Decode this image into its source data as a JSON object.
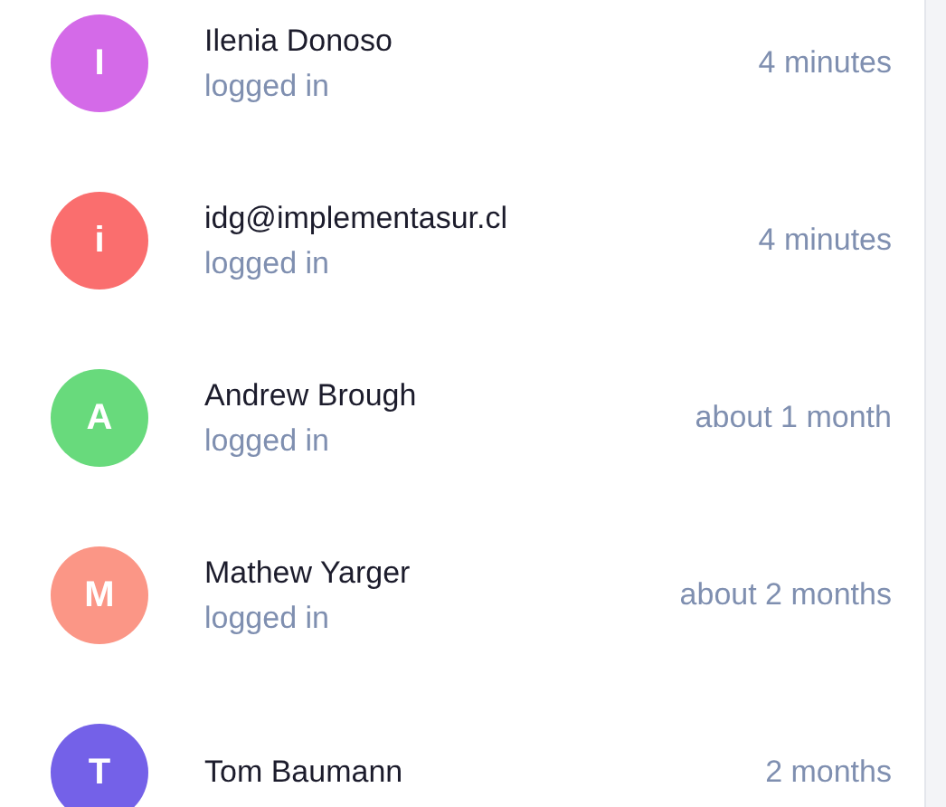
{
  "activity": [
    {
      "initial": "I",
      "color": "#d46ae8",
      "name": "Ilenia Donoso",
      "action": "logged in",
      "time": "4 minutes"
    },
    {
      "initial": "i",
      "color": "#fa6e6e",
      "name": "idg@implementasur.cl",
      "action": "logged in",
      "time": "4 minutes"
    },
    {
      "initial": "A",
      "color": "#68da7c",
      "name": "Andrew Brough",
      "action": "logged in",
      "time": "about 1 month"
    },
    {
      "initial": "M",
      "color": "#fb9686",
      "name": "Mathew Yarger",
      "action": "logged in",
      "time": "about 2 months"
    },
    {
      "initial": "T",
      "color": "#7461e8",
      "name": "Tom Baumann",
      "time": "2 months"
    }
  ]
}
